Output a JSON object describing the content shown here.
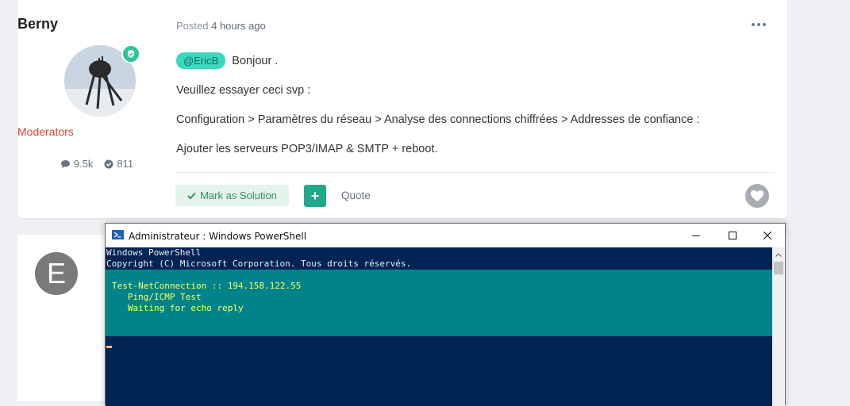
{
  "post": {
    "author": "Berny",
    "group": "Moderators",
    "stats": {
      "posts": "9.5k",
      "solutions": "811"
    },
    "meta_prefix": "Posted",
    "meta_time": "4 hours ago",
    "mention": "@EricB",
    "greeting": " Bonjour .",
    "line2": "Veuillez essayer ceci svp :",
    "line3": "Configuration > Paramètres du réseau > Analyse des connections chiffrées > Addresses de confiance :",
    "line4": "Ajouter les serveurs POP3/IMAP & SMTP + reboot.",
    "mark_solution": "Mark as Solution",
    "plus": "+",
    "quote": "Quote"
  },
  "post2": {
    "avatar_letter": "E"
  },
  "powershell": {
    "title": "Administrateur : Windows PowerShell",
    "lines": [
      "Windows PowerShell",
      "Copyright (C) Microsoft Corporation. Tous droits réservés."
    ],
    "progress": [
      "Test-NetConnection :: 194.158.122.55",
      "   Ping/ICMP Test",
      "",
      "   Waiting for echo reply"
    ]
  },
  "colors": {
    "accent": "#1fa88b",
    "mention_bg": "#3bd8c0",
    "group": "#e0423a",
    "console_bg": "#012456",
    "progress_bg": "#00848a",
    "progress_text": "#ffff60"
  },
  "icons": [
    "shield-check-icon",
    "comment-icon",
    "check-circle-icon",
    "more-icon",
    "check-icon",
    "heart-icon",
    "powershell-icon",
    "minimize-icon",
    "maximize-icon",
    "close-icon"
  ]
}
